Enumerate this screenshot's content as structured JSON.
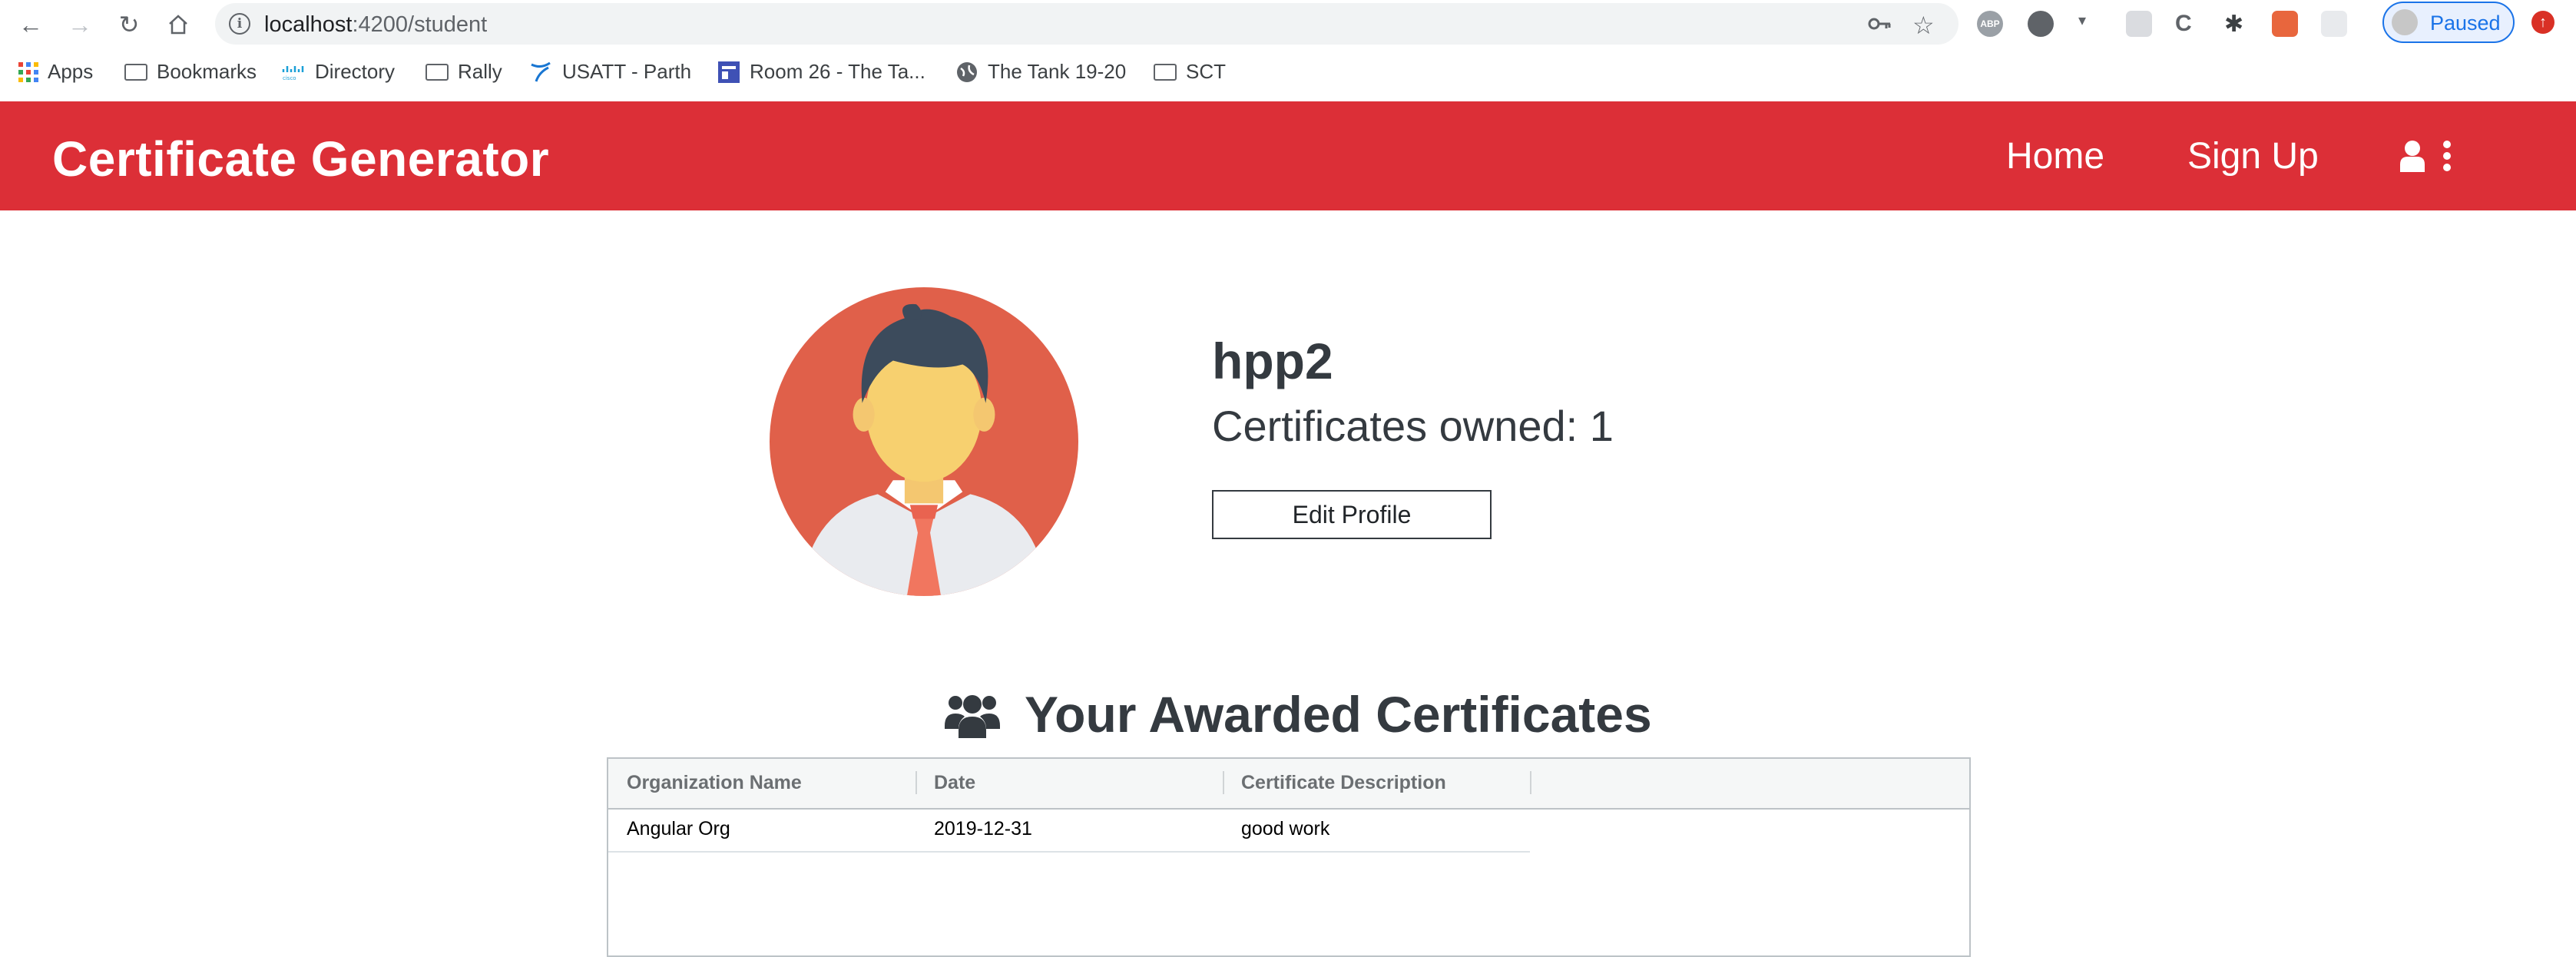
{
  "browser": {
    "url_host": "localhost",
    "url_path": ":4200/student",
    "profile_label": "Paused",
    "bookmarks": [
      {
        "label": "Apps"
      },
      {
        "label": "Bookmarks"
      },
      {
        "label": "Directory"
      },
      {
        "label": "Rally"
      },
      {
        "label": "USATT - Parth"
      },
      {
        "label": "Room 26 - The Ta..."
      },
      {
        "label": "The Tank 19-20"
      },
      {
        "label": "SCT"
      }
    ]
  },
  "navbar": {
    "brand": "Certificate Generator",
    "links": [
      "Home",
      "Sign Up"
    ],
    "color": "#dc2f37"
  },
  "profile": {
    "username": "hpp2",
    "certificates_owned": "Certificates owned: 1",
    "edit_button": "Edit Profile"
  },
  "certificates": {
    "title": "Your Awarded Certificates",
    "columns": [
      "Organization Name",
      "Date",
      "Certificate Description"
    ],
    "rows": [
      {
        "org": "Angular Org",
        "date": "2019-12-31",
        "description": "good work"
      }
    ]
  }
}
